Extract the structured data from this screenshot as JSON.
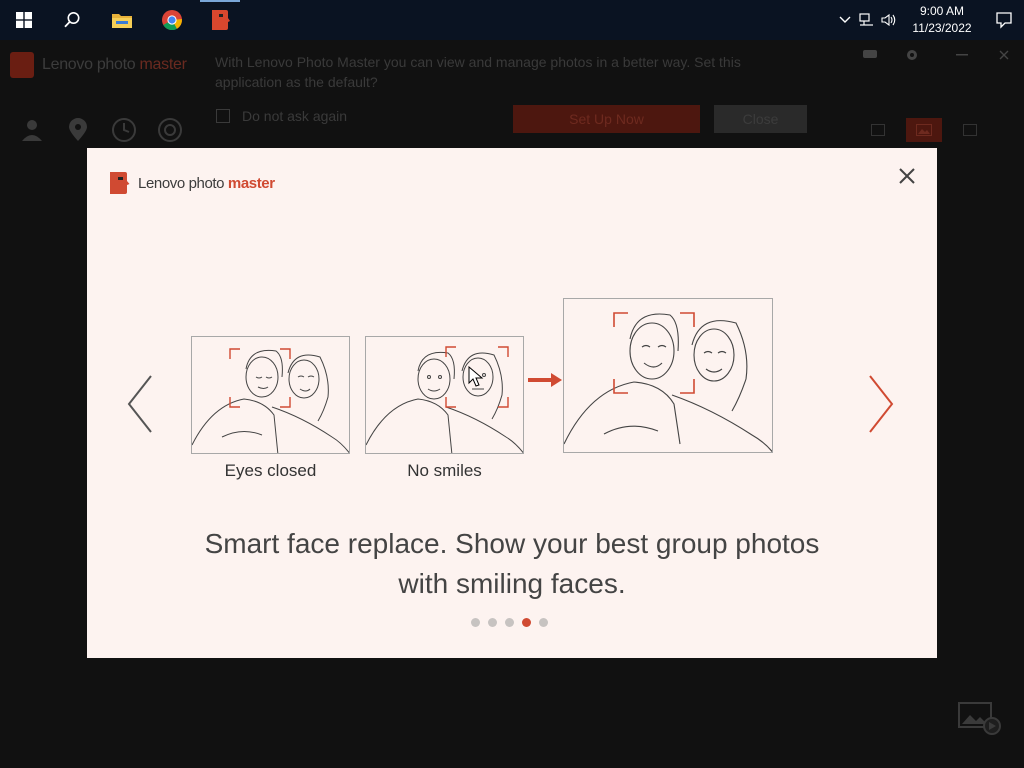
{
  "taskbar": {
    "time": "9:00 AM",
    "date": "11/23/2022"
  },
  "app": {
    "logo_prefix": "Lenovo photo ",
    "logo_accent": "master",
    "banner_message": "With Lenovo Photo Master you can view and manage photos in a better way. Set this application as the default?",
    "banner_checkbox_label": "Do not ask again",
    "setup_button": "Set Up Now",
    "close_button": "Close"
  },
  "modal": {
    "logo_prefix": "Lenovo photo ",
    "logo_accent": "master",
    "caption_1": "Eyes closed",
    "caption_2": "No smiles",
    "headline_line1": "Smart face replace. Show your best group photos",
    "headline_line2": "with smiling faces.",
    "pages": 5,
    "current_page": 4
  },
  "colors": {
    "accent": "#d04a32",
    "modal_bg": "#fdf3f0",
    "taskbar": "#0a1322"
  },
  "icons": [
    "windows-start-icon",
    "search-icon",
    "file-explorer-icon",
    "chrome-icon",
    "photo-master-icon",
    "chevron-up-icon",
    "network-icon",
    "volume-icon",
    "notification-icon",
    "close-icon",
    "chevron-left-icon",
    "chevron-right-icon",
    "arrow-right-icon"
  ]
}
